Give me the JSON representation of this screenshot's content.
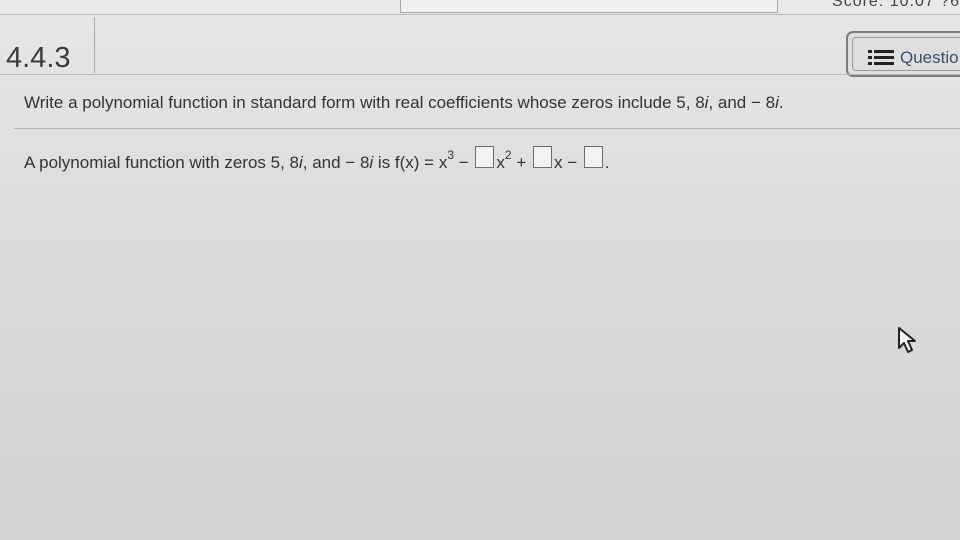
{
  "top_bar": {
    "score_text": "Score: 10.07 ?6"
  },
  "header": {
    "section_number": "4.4.3",
    "question_button_label": "Questio"
  },
  "question": {
    "prompt_prefix": "Write a polynomial function in standard form with real coefficients whose zeros include 5, 8",
    "prompt_i1": "i",
    "prompt_mid": ", and − 8",
    "prompt_i2": "i",
    "prompt_end": ".",
    "answer_prefix": "A polynomial function with zeros 5, 8",
    "answer_i1": "i",
    "answer_mid": ", and − 8",
    "answer_i2": "i",
    "answer_is": " is f(x) = x",
    "exp3": "3",
    "minus1": " − ",
    "x2": "x",
    "exp2": "2",
    "plus": " + ",
    "x1": "x",
    "minus2": " − ",
    "period": "."
  },
  "icons": {
    "list": "list-icon",
    "cursor": "mouse-pointer-icon"
  }
}
